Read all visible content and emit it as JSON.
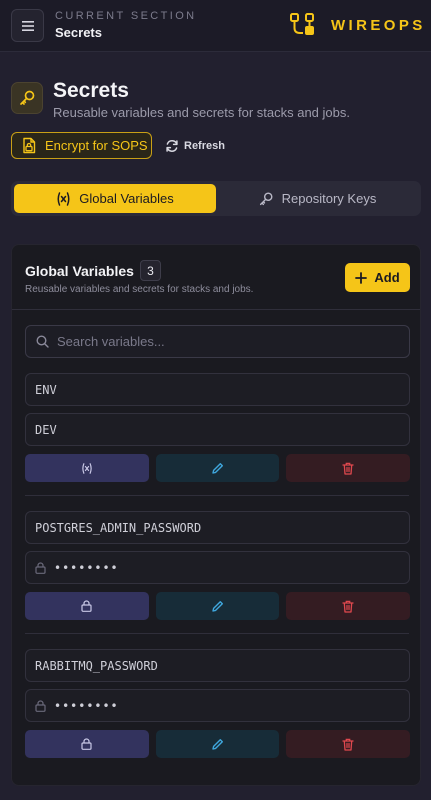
{
  "header": {
    "section_label": "CURRENT SECTION",
    "section_name": "Secrets",
    "brand": "WIREOPS",
    "accent": "#f5c518"
  },
  "page": {
    "title": "Secrets",
    "subtitle": "Reusable variables and secrets for stacks and jobs.",
    "encrypt_button": "Encrypt for SOPS",
    "refresh_button": "Refresh"
  },
  "tabs": [
    {
      "label": "Global Variables",
      "icon": "variable-icon",
      "active": true
    },
    {
      "label": "Repository Keys",
      "icon": "key-icon",
      "active": false
    }
  ],
  "card": {
    "title": "Global Variables",
    "count": "3",
    "subtitle": "Reusable variables and secrets for stacks and jobs.",
    "add_button": "Add",
    "search_placeholder": "Search variables..."
  },
  "variables": [
    {
      "name": "ENV",
      "value": "DEV",
      "secret": false
    },
    {
      "name": "POSTGRES_ADMIN_PASSWORD",
      "value": "••••••••",
      "secret": true
    },
    {
      "name": "RABBITMQ_PASSWORD",
      "value": "••••••••",
      "secret": true
    }
  ]
}
